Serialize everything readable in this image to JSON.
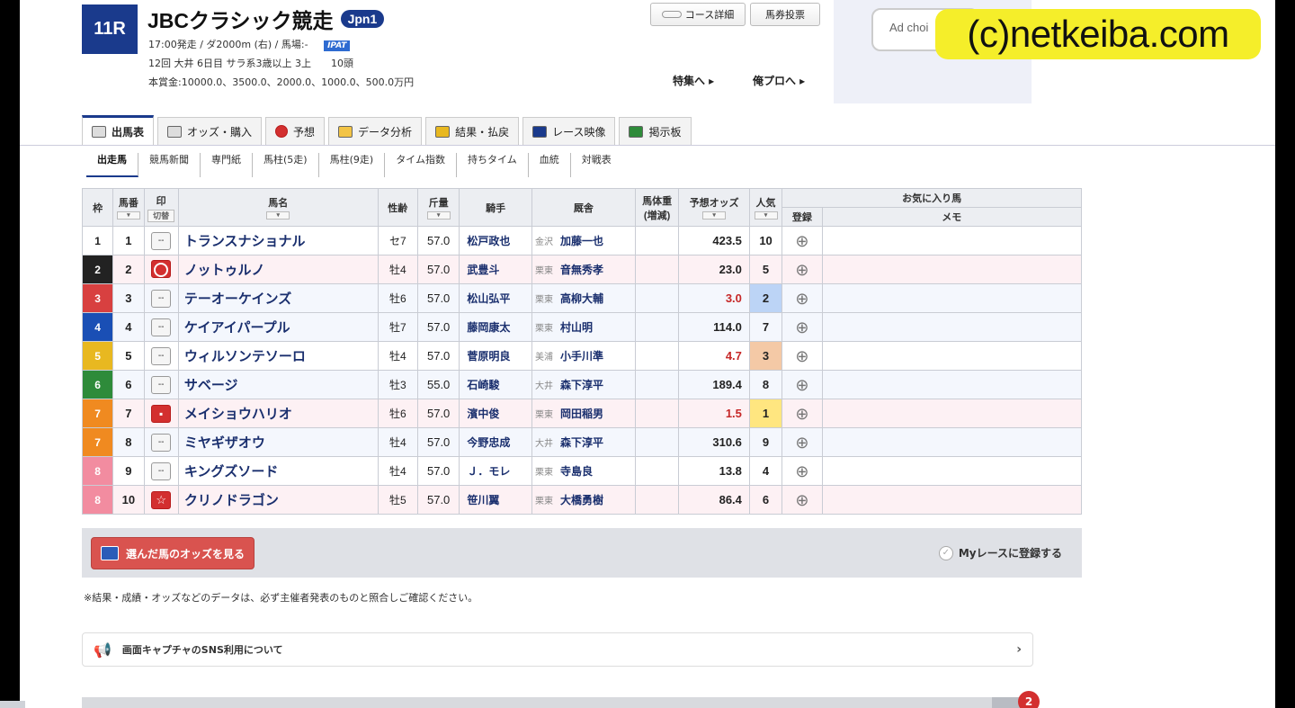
{
  "race": {
    "number": "11R",
    "title": "JBCクラシック競走",
    "grade": "Jpn1",
    "info1": "17:00発走 / ダ2000m (右) / 馬場:-",
    "ipat": "IPAT",
    "info2": "12回 大井 6日目 サラ系3歳以上 3上　　10頭",
    "info3": "本賞金:10000.0、3500.0、2000.0、1000.0、500.0万円"
  },
  "header_buttons": {
    "course": "コース詳細",
    "bet": "馬券投票"
  },
  "header_links": {
    "special": "特集へ ▸",
    "ore": "俺プロへ ▸"
  },
  "ad": {
    "choices": "Ad choi"
  },
  "watermark": "(c)netkeiba.com",
  "tabs": [
    {
      "label": "出馬表"
    },
    {
      "label": "オッズ・購入"
    },
    {
      "label": "予想"
    },
    {
      "label": "データ分析"
    },
    {
      "label": "結果・払戻"
    },
    {
      "label": "レース映像"
    },
    {
      "label": "掲示板"
    }
  ],
  "subnav": [
    "出走馬",
    "競馬新聞",
    "専門紙",
    "馬柱(5走)",
    "馬柱(9走)",
    "タイム指数",
    "持ちタイム",
    "血統",
    "対戦表"
  ],
  "columns": {
    "waku": "枠",
    "umaban": "馬番",
    "mark": "印",
    "mark_sub": "切替",
    "name": "馬名",
    "sexage": "性齢",
    "weight": "斤量",
    "jockey": "騎手",
    "trainer": "厩舎",
    "bodyweight": "馬体重(増減)",
    "odds": "予想オッズ",
    "popularity": "人気",
    "favorite": "お気に入り馬",
    "register": "登録",
    "memo": "メモ"
  },
  "horses": [
    {
      "waku": "1",
      "waku_color": "#ffffff",
      "waku_text": "#222222",
      "num": "1",
      "mark": "--",
      "mark_type": "none",
      "name": "トランスナショナル",
      "sexage": "セ7",
      "weight": "57.0",
      "jockey": "松戸政也",
      "region": "金沢",
      "trainer": "加藤一也",
      "odds": "423.5",
      "odds_red": false,
      "pop": "10",
      "pop_class": "",
      "tint": "odd"
    },
    {
      "waku": "2",
      "waku_color": "#222222",
      "waku_text": "#ffffff",
      "num": "2",
      "mark": "",
      "mark_type": "circle",
      "name": "ノットゥルノ",
      "sexage": "牡4",
      "weight": "57.0",
      "jockey": "武豊斗",
      "region": "栗東",
      "trainer": "音無秀孝",
      "odds": "23.0",
      "odds_red": false,
      "pop": "5",
      "pop_class": "",
      "tint": "pink"
    },
    {
      "waku": "3",
      "waku_color": "#d84040",
      "waku_text": "#ffffff",
      "num": "3",
      "mark": "--",
      "mark_type": "none",
      "name": "テーオーケインズ",
      "sexage": "牡6",
      "weight": "57.0",
      "jockey": "松山弘平",
      "region": "栗東",
      "trainer": "高柳大輔",
      "odds": "3.0",
      "odds_red": true,
      "pop": "2",
      "pop_class": "p2",
      "tint": "blue"
    },
    {
      "waku": "4",
      "waku_color": "#1a4fb5",
      "waku_text": "#ffffff",
      "num": "4",
      "mark": "--",
      "mark_type": "none",
      "name": "ケイアイパープル",
      "sexage": "牡7",
      "weight": "57.0",
      "jockey": "藤岡康太",
      "region": "栗東",
      "trainer": "村山明",
      "odds": "114.0",
      "odds_red": false,
      "pop": "7",
      "pop_class": "",
      "tint": "blue"
    },
    {
      "waku": "5",
      "waku_color": "#e8b820",
      "waku_text": "#ffffff",
      "num": "5",
      "mark": "--",
      "mark_type": "none",
      "name": "ウィルソンテソーロ",
      "sexage": "牡4",
      "weight": "57.0",
      "jockey": "菅原明良",
      "region": "美浦",
      "trainer": "小手川準",
      "odds": "4.7",
      "odds_red": true,
      "pop": "3",
      "pop_class": "p3",
      "tint": "odd"
    },
    {
      "waku": "6",
      "waku_color": "#2e8b3a",
      "waku_text": "#ffffff",
      "num": "6",
      "mark": "--",
      "mark_type": "none",
      "name": "サベージ",
      "sexage": "牡3",
      "weight": "55.0",
      "jockey": "石崎駿",
      "region": "大井",
      "trainer": "森下淳平",
      "odds": "189.4",
      "odds_red": false,
      "pop": "8",
      "pop_class": "",
      "tint": "blue"
    },
    {
      "waku": "7",
      "waku_color": "#f08a20",
      "waku_text": "#ffffff",
      "num": "7",
      "mark": "",
      "mark_type": "dot",
      "name": "メイショウハリオ",
      "sexage": "牡6",
      "weight": "57.0",
      "jockey": "濱中俊",
      "region": "栗東",
      "trainer": "岡田稲男",
      "odds": "1.5",
      "odds_red": true,
      "pop": "1",
      "pop_class": "p1",
      "tint": "pink"
    },
    {
      "waku": "7",
      "waku_color": "#f08a20",
      "waku_text": "#ffffff",
      "num": "8",
      "mark": "--",
      "mark_type": "none",
      "name": "ミヤギザオウ",
      "sexage": "牡4",
      "weight": "57.0",
      "jockey": "今野忠成",
      "region": "大井",
      "trainer": "森下淳平",
      "odds": "310.6",
      "odds_red": false,
      "pop": "9",
      "pop_class": "",
      "tint": "blue"
    },
    {
      "waku": "8",
      "waku_color": "#f28ca0",
      "waku_text": "#ffffff",
      "num": "9",
      "mark": "--",
      "mark_type": "none",
      "name": "キングズソード",
      "sexage": "牡4",
      "weight": "57.0",
      "jockey": "Ｊ．モレ",
      "region": "栗東",
      "trainer": "寺島良",
      "odds": "13.8",
      "odds_red": false,
      "pop": "4",
      "pop_class": "",
      "tint": "odd"
    },
    {
      "waku": "8",
      "waku_color": "#f28ca0",
      "waku_text": "#ffffff",
      "num": "10",
      "mark": "☆",
      "mark_type": "star",
      "name": "クリノドラゴン",
      "sexage": "牡5",
      "weight": "57.0",
      "jockey": "笹川翼",
      "region": "栗東",
      "trainer": "大橋勇樹",
      "odds": "86.4",
      "odds_red": false,
      "pop": "6",
      "pop_class": "",
      "tint": "pink"
    }
  ],
  "actions": {
    "odds_button": "選んだ馬のオッズを見る",
    "my_race": "Myレースに登録する"
  },
  "note": "※結果・成績・オッズなどのデータは、必ず主催者発表のものと照合しご確認ください。",
  "sns": {
    "label": "画面キャプチャのSNS利用について",
    "chevron": "›"
  },
  "badge": "2"
}
